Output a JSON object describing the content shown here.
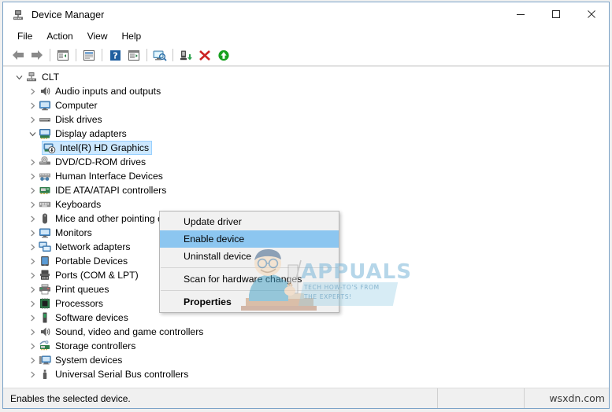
{
  "window": {
    "title": "Device Manager",
    "icon": "device-manager-icon",
    "buttons": {
      "minimize": "–",
      "maximize": "□",
      "close": "✕"
    }
  },
  "menubar": {
    "items": [
      {
        "label": "File"
      },
      {
        "label": "Action"
      },
      {
        "label": "View"
      },
      {
        "label": "Help"
      }
    ]
  },
  "toolbar": {
    "buttons": [
      {
        "name": "back-arrow-icon",
        "tip": "Back"
      },
      {
        "name": "forward-arrow-icon",
        "tip": "Forward"
      },
      {
        "name": "show-hide-console-tree-icon",
        "tip": "Show/Hide Console Tree"
      },
      {
        "name": "properties-icon",
        "tip": "Properties"
      },
      {
        "name": "help-icon",
        "tip": "Help"
      },
      {
        "name": "update-driver-icon",
        "tip": "Update Driver Software"
      },
      {
        "name": "scan-hardware-changes-icon",
        "tip": "Scan for hardware changes"
      },
      {
        "name": "disable-device-icon",
        "tip": "Disable device"
      },
      {
        "name": "uninstall-device-icon",
        "tip": "Uninstall device"
      },
      {
        "name": "enable-device-icon",
        "tip": "Enable device"
      }
    ]
  },
  "tree": {
    "root": {
      "label": "CLT",
      "icon": "computer-node-icon",
      "expanded": true
    },
    "items": [
      {
        "label": "Audio inputs and outputs",
        "icon": "speaker-icon",
        "level": 1,
        "expanded": false
      },
      {
        "label": "Computer",
        "icon": "monitor-icon",
        "level": 1,
        "expanded": false
      },
      {
        "label": "Disk drives",
        "icon": "disk-drive-icon",
        "level": 1,
        "expanded": false
      },
      {
        "label": "Display adapters",
        "icon": "display-adapter-icon",
        "level": 1,
        "expanded": true
      },
      {
        "label": "Intel(R) HD Graphics",
        "icon": "disabled-display-device-icon",
        "level": 2,
        "selected": true
      },
      {
        "label": "DVD/CD-ROM drives",
        "icon": "optical-drive-icon",
        "level": 1,
        "expanded": false
      },
      {
        "label": "Human Interface Devices",
        "icon": "hid-icon",
        "level": 1,
        "expanded": false
      },
      {
        "label": "IDE ATA/ATAPI controllers",
        "icon": "ide-controller-icon",
        "level": 1,
        "expanded": false
      },
      {
        "label": "Keyboards",
        "icon": "keyboard-icon",
        "level": 1,
        "expanded": false
      },
      {
        "label": "Mice and other pointing devices",
        "icon": "mouse-icon",
        "level": 1,
        "expanded": false
      },
      {
        "label": "Monitors",
        "icon": "monitor-icon",
        "level": 1,
        "expanded": false
      },
      {
        "label": "Network adapters",
        "icon": "network-adapter-icon",
        "level": 1,
        "expanded": false
      },
      {
        "label": "Portable Devices",
        "icon": "portable-device-icon",
        "level": 1,
        "expanded": false
      },
      {
        "label": "Ports (COM & LPT)",
        "icon": "port-icon",
        "level": 1,
        "expanded": false
      },
      {
        "label": "Print queues",
        "icon": "printer-icon",
        "level": 1,
        "expanded": false
      },
      {
        "label": "Processors",
        "icon": "processor-icon",
        "level": 1,
        "expanded": false
      },
      {
        "label": "Software devices",
        "icon": "software-device-icon",
        "level": 1,
        "expanded": false
      },
      {
        "label": "Sound, video and game controllers",
        "icon": "speaker-icon",
        "level": 1,
        "expanded": false
      },
      {
        "label": "Storage controllers",
        "icon": "storage-controller-icon",
        "level": 1,
        "expanded": false
      },
      {
        "label": "System devices",
        "icon": "system-device-icon",
        "level": 1,
        "expanded": false
      },
      {
        "label": "Universal Serial Bus controllers",
        "icon": "usb-icon",
        "level": 1,
        "expanded": false
      }
    ]
  },
  "context_menu": {
    "items": [
      {
        "label": "Update driver",
        "type": "item"
      },
      {
        "label": "Enable device",
        "type": "item",
        "highlighted": true
      },
      {
        "label": "Uninstall device",
        "type": "item"
      },
      {
        "type": "separator"
      },
      {
        "label": "Scan for hardware changes",
        "type": "item"
      },
      {
        "type": "separator"
      },
      {
        "label": "Properties",
        "type": "item",
        "bold": true
      }
    ]
  },
  "statusbar": {
    "message": "Enables the selected device.",
    "middle": "",
    "right": "wsxdn.com"
  },
  "watermark": {
    "word": "APPUALS",
    "line1": "TECH HOW-TO'S FROM",
    "line2": "THE EXPERTS!"
  },
  "colors": {
    "window_border": "#7ba3c8",
    "selection": "#cce8ff",
    "menu_highlight": "#8cc6f0",
    "statusbar_bg": "#f0f0f0",
    "menu_bg": "#f1f1f1"
  }
}
